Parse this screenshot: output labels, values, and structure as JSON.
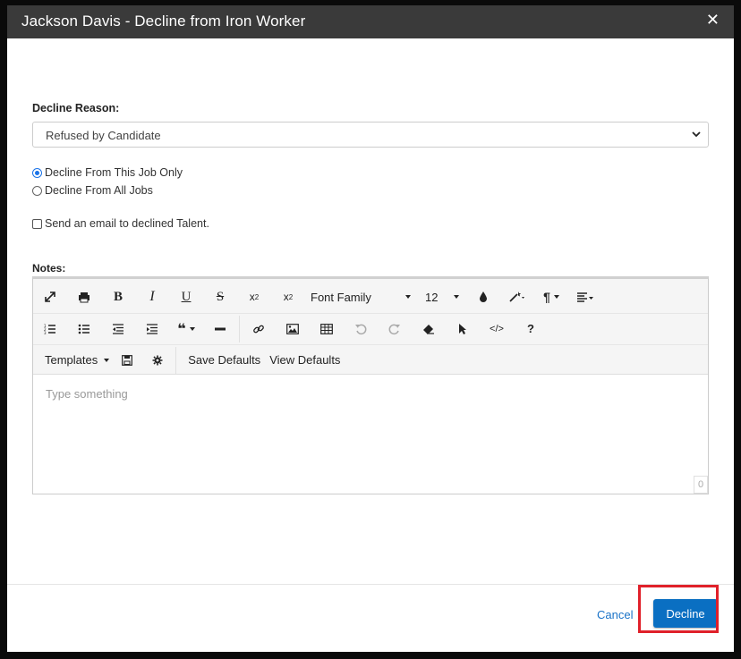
{
  "dialog": {
    "title": "Jackson Davis - Decline from Iron Worker",
    "close_icon": "close-icon"
  },
  "form": {
    "decline_reason_label": "Decline Reason:",
    "decline_reason_value": "Refused by Candidate",
    "radio_options": [
      {
        "label": "Decline From This Job Only",
        "checked": true
      },
      {
        "label": "Decline From All Jobs",
        "checked": false
      }
    ],
    "email_checkbox": {
      "label": "Send an email to declined Talent.",
      "checked": false
    },
    "notes_label": "Notes:"
  },
  "editor": {
    "font_family": "Font Family",
    "font_size": "12",
    "templates_label": "Templates",
    "save_defaults_label": "Save Defaults",
    "view_defaults_label": "View Defaults",
    "placeholder": "Type something",
    "char_count": "0",
    "toolbar_icons": [
      "fullscreen-icon",
      "print-icon",
      "bold-icon",
      "italic-icon",
      "underline-icon",
      "strikethrough-icon",
      "subscript-icon",
      "superscript-icon",
      "color-icon",
      "magic-icon",
      "paragraph-icon",
      "align-icon",
      "ordered-list-icon",
      "unordered-list-icon",
      "outdent-icon",
      "indent-icon",
      "quote-icon",
      "hr-icon",
      "link-icon",
      "image-icon",
      "table-icon",
      "undo-icon",
      "redo-icon",
      "eraser-icon",
      "select-icon",
      "code-icon",
      "help-icon",
      "save-icon",
      "gear-icon"
    ]
  },
  "footer": {
    "cancel_label": "Cancel",
    "decline_label": "Decline"
  },
  "colors": {
    "header_bg": "#3a3a3a",
    "primary": "#0a6fc2",
    "link": "#1a73c8",
    "highlight": "#e0202a"
  }
}
